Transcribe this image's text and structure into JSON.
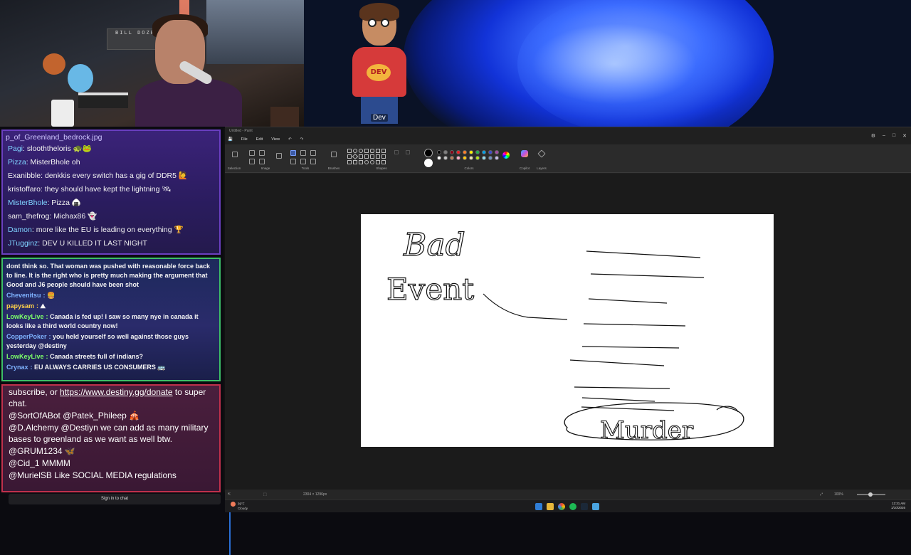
{
  "stream": {
    "webcam_shelf_text": "BILL DOZER",
    "avatar_name": "Dev",
    "avatar_shirt_text": "DEV"
  },
  "chat1": {
    "top_text": "p_of_Greenland_bedrock.jpg",
    "messages": [
      {
        "user": "Pagi",
        "text": "slooththeloris 🐢🐸",
        "color": "#7fd3ff"
      },
      {
        "user": "Pizza",
        "text": "MisterBhole oh",
        "color": "#7fd3ff"
      },
      {
        "user": "Exanibble",
        "text": "denkkis every switch has a gig of DDR5 🙋",
        "color": "#f2f2f2"
      },
      {
        "user": "kristoffaro",
        "text": "they should have kept the lightning 🛰",
        "color": "#f2f2f2"
      },
      {
        "user": "MisterBhole",
        "text": "Pizza 🍙",
        "color": "#7fd3ff"
      },
      {
        "user": "sam_thefrog",
        "text": "Michax86 👻",
        "color": "#f2f2f2"
      },
      {
        "user": "Damon",
        "text": "more like the EU is leading on everything 🏆",
        "color": "#7fd3ff"
      },
      {
        "user": "JTugginz",
        "text": "DEV U KILLED IT LAST NIGHT",
        "color": "#7fd3ff"
      }
    ]
  },
  "chat2": {
    "messages": [
      {
        "user": "",
        "text": "dont think so. That woman was pushed with reasonable force back to line. It is the right who is pretty much making the argument that Good and J6 people should have been shot",
        "color": "#ffffff"
      },
      {
        "user": "Chevenitsu",
        "text": "🍔",
        "color": "#7fb3ff"
      },
      {
        "user": "papysam",
        "text": "⛰",
        "color": "#ffd24a"
      },
      {
        "user": "LowKeyLive",
        "text": "Canada is fed up! I saw so many nye in canada it looks like a third world country now!",
        "color": "#7dff6a"
      },
      {
        "user": "CopperPoker",
        "text": "you held yourself so well against those guys yesterday @destiny",
        "color": "#7fb3ff"
      },
      {
        "user": "LowKeyLive",
        "text": "Canada streets full of indians?",
        "color": "#7dff6a"
      },
      {
        "user": "Crynax",
        "text": "EU ALWAYS CARRIES US CONSUMERS 🚌",
        "color": "#7fb3ff"
      }
    ]
  },
  "chat3": {
    "intro_pre": "subscribe, or ",
    "intro_link": "https://www.destiny.gg/donate",
    "intro_post": " to super chat.",
    "messages": [
      {
        "user": "@SortOfABot",
        "text": "@Patek_Phileep 🎪"
      },
      {
        "user": "@D.Alchemy",
        "text": "@Destiyn we can add as many military bases to greenland as we want as well btw."
      },
      {
        "user": "@GRUM1234",
        "text": "🦋"
      },
      {
        "user": "@Cid_1",
        "text": "MMMM"
      },
      {
        "user": "@MurielSB",
        "text": "Like SOCIAL MEDIA regulations"
      }
    ],
    "signin_label": "Sign in to chat"
  },
  "paint": {
    "title": "Untitled - Paint",
    "menu": [
      "File",
      "Edit",
      "View"
    ],
    "groups": [
      "Selection",
      "Image",
      "Tools",
      "Brushes",
      "Shapes",
      "Colors",
      "Copilot",
      "Layers"
    ],
    "palette_row1": [
      "#000000",
      "#7f7f7f",
      "#880015",
      "#ed1c24",
      "#ff7f27",
      "#fff200",
      "#22b14c",
      "#00a2e8",
      "#3f48cc",
      "#a349a4"
    ],
    "palette_row2": [
      "#ffffff",
      "#c3c3c3",
      "#b97a57",
      "#ffaec9",
      "#ffc90e",
      "#efe4b0",
      "#b5e61d",
      "#99d9ea",
      "#7092be",
      "#c8bfe7"
    ],
    "status_size": "2304 × 1296px",
    "zoom": "100%",
    "canvas_text": {
      "line1": "Bad",
      "line2": "Event",
      "line3": "Murder"
    }
  },
  "taskbar": {
    "weather_temp": "39°F",
    "weather_desc": "Cloudy",
    "time": "12:31 AM",
    "date": "1/10/2026"
  }
}
